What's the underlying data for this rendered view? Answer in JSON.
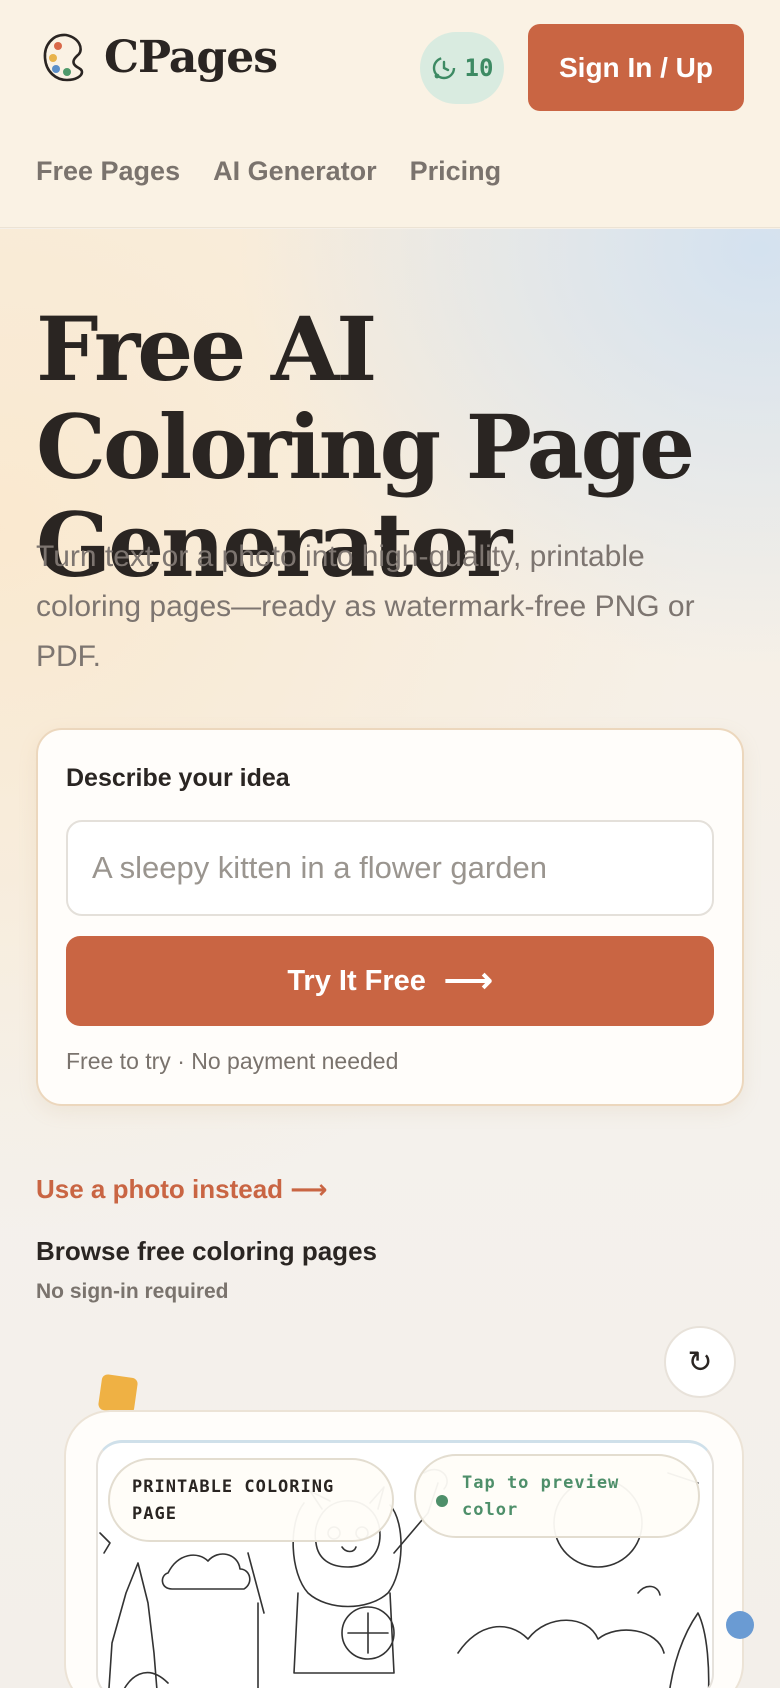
{
  "brand": {
    "name": "CPages",
    "logo_icon": "palette-icon"
  },
  "header": {
    "credits": {
      "count": "10",
      "icon": "credits-icon"
    },
    "signin_label": "Sign In / Up"
  },
  "nav": {
    "items": [
      "Free Pages",
      "AI Generator",
      "Pricing"
    ]
  },
  "hero": {
    "title": "Free AI Coloring Page Generator",
    "subtitle": "Turn text or a photo into high-quality, printable coloring pages—ready as watermark-free PNG or PDF."
  },
  "generator": {
    "label": "Describe your idea",
    "placeholder": "A sleepy kitten in a flower garden",
    "value": "",
    "button_label": "Try It Free",
    "button_icon": "arrow-right-icon",
    "note": "Free to try · No payment needed"
  },
  "photo_link": "Use a photo instead ⟶",
  "browse": {
    "title": "Browse free coloring pages",
    "subtitle": "No sign-in required",
    "refresh_icon": "refresh-icon"
  },
  "preview": {
    "badge_left": "PRINTABLE COLORING PAGE",
    "badge_right": "Tap to preview color"
  },
  "colors": {
    "accent": "#c96543",
    "credits_bg": "#d9ebe0",
    "credits_text": "#3d8a63",
    "text": "#2a2522",
    "muted": "#7a736d"
  }
}
